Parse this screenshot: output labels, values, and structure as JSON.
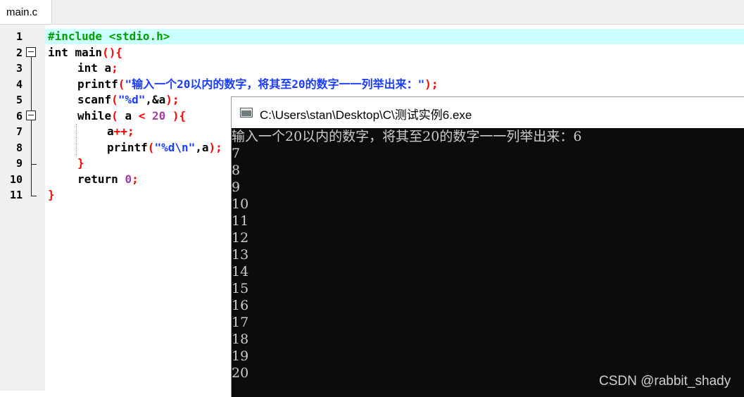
{
  "tab": {
    "label": "main.c"
  },
  "gutter": {
    "line_numbers": [
      "1",
      "2",
      "3",
      "4",
      "5",
      "6",
      "7",
      "8",
      "9",
      "10",
      "11"
    ]
  },
  "code": {
    "l1": {
      "pre": "#include <stdio.h>"
    },
    "l2": {
      "kw": "int main",
      "pn": "(){"
    },
    "l3": {
      "kw": "int a",
      "pn": ";"
    },
    "l4": {
      "fn": "printf",
      "p1": "(",
      "str": "\"输入一个20以内的数字，将其至20的数字一一列举出来：\"",
      "p2": ");"
    },
    "l5": {
      "fn": "scanf",
      "p1": "(",
      "str": "\"%d\"",
      "rest": ",&a",
      "p2": ");"
    },
    "l6": {
      "kw": "while",
      "p1": "( ",
      "var": "a ",
      "op": "<",
      "num": " 20 ",
      "p2": "){"
    },
    "l7": {
      "var": "a",
      "op": "++",
      "pn": ";"
    },
    "l8": {
      "fn": "printf",
      "p1": "(",
      "str": "\"%d\\n\"",
      "rest": ",a",
      "p2": ");"
    },
    "l9": {
      "pn": "}"
    },
    "l10": {
      "kw": "return ",
      "num": "0",
      "pn": ";"
    },
    "l11": {
      "pn": "}"
    }
  },
  "console": {
    "title": "C:\\Users\\stan\\Desktop\\C\\测试实例6.exe",
    "lines": [
      "输入一个20以内的数字，将其至20的数字一一列举出来：6",
      "7",
      "8",
      "9",
      "10",
      "11",
      "12",
      "13",
      "14",
      "15",
      "16",
      "17",
      "18",
      "19",
      "20"
    ]
  },
  "watermark": "CSDN @rabbit_shady"
}
